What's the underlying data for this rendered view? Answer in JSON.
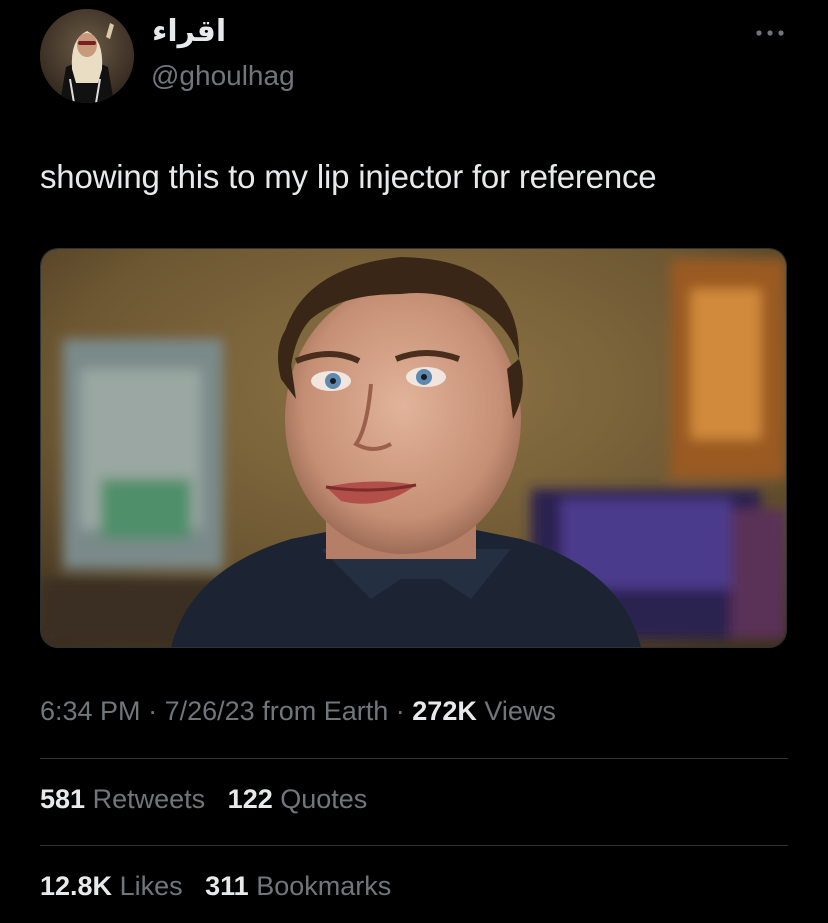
{
  "author": {
    "display_name": "اقراء",
    "handle": "@ghoulhag",
    "avatar_icon": "profile-photo"
  },
  "more_icon": "ellipsis-icon",
  "tweet": {
    "text": "showing this to my lip injector for reference"
  },
  "media": {
    "icon": "photo-of-smiling-man"
  },
  "meta": {
    "time": "6:34 PM",
    "sep1": "·",
    "date": "7/26/23",
    "source": "from Earth",
    "sep2": "·",
    "views_count": "272K",
    "views_label": "Views"
  },
  "stats": {
    "retweets_count": "581",
    "retweets_label": "Retweets",
    "quotes_count": "122",
    "quotes_label": "Quotes",
    "likes_count": "12.8K",
    "likes_label": "Likes",
    "bookmarks_count": "311",
    "bookmarks_label": "Bookmarks"
  },
  "colors": {
    "background": "#000000",
    "primary_text": "#e7e9ea",
    "secondary_text": "#71767b",
    "divider": "#2f3336"
  }
}
